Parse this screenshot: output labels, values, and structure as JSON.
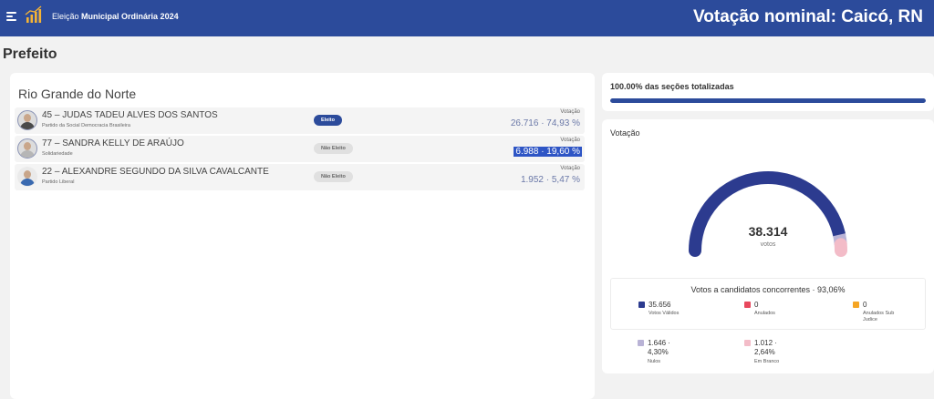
{
  "header": {
    "brand_prefix": "Eleição",
    "brand_bold": "Municipal Ordinária 2024",
    "title": "Votação nominal: Caicó, RN"
  },
  "section_title": "Prefeito",
  "state_title": "Rio Grande do Norte",
  "candidates": [
    {
      "name": "45 – JUDAS TADEU ALVES DOS SANTOS",
      "party": "Partido da Social Democracia Brasileira",
      "status": "Eleito",
      "vote_label": "Votação",
      "votes": "26.716 · 74,93 %"
    },
    {
      "name": "77 – SANDRA KELLY DE ARAÚJO",
      "party": "Solidariedade",
      "status": "Não Eleito",
      "vote_label": "Votação",
      "votes": "6.988 · 19,60 %"
    },
    {
      "name": "22 – ALEXANDRE SEGUNDO DA SILVA CAVALCANTE",
      "party": "Partido Liberal",
      "status": "Não Eleito",
      "vote_label": "Votação",
      "votes": "1.952 · 5,47 %"
    }
  ],
  "progress": {
    "text": "100.00% das seções totalizadas",
    "fraction": 1.0
  },
  "vote_panel": {
    "title": "Votação",
    "total": "38.314",
    "total_unit": "votos",
    "gauge_fractions": {
      "valid": 0.9306,
      "null": 0.043,
      "blank": 0.0264
    },
    "breakdown_title": "Votos a candidatos concorrentes · 93,06%",
    "stats": [
      {
        "value": "35.656",
        "label": "Votos Válidos",
        "color": "#2c3b8f"
      },
      {
        "value": "0",
        "label": "Anulados",
        "color": "#e8485d"
      },
      {
        "value": "0",
        "label": "Anulados Sub Judice",
        "color": "#f5a524"
      },
      {
        "value": "1.646 · 4,30%",
        "label": "Nulos",
        "color": "#b9b3d6"
      },
      {
        "value": "1.012 · 2,64%",
        "label": "Em Branco",
        "color": "#f3bcc8"
      }
    ]
  },
  "colors": {
    "primary": "#2c4b9b",
    "highlight": "#2e55c5"
  }
}
